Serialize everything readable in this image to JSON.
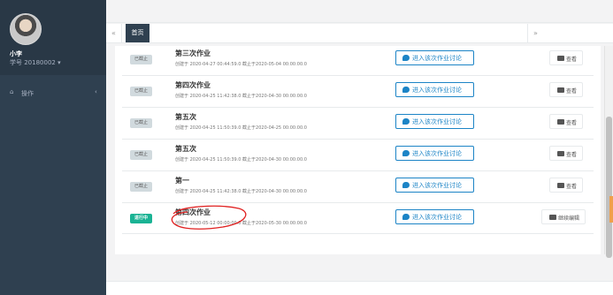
{
  "user": {
    "name": "小李",
    "student_id": "学号 20180002 ▾"
  },
  "sidebar": {
    "items": [
      {
        "label": "操作"
      }
    ]
  },
  "tabs": {
    "prev": "«",
    "next": "»",
    "items": [
      {
        "label": "首页"
      }
    ]
  },
  "assignments": [
    {
      "status": "已截止",
      "status_type": "closed",
      "title": "第三次作业",
      "meta": "创建于 2020-04-27 00:44:59.0 截止于2020-05-04 00:00:00.0",
      "discuss_label": "进入该次作业讨论",
      "action_label": "查看"
    },
    {
      "status": "已截止",
      "status_type": "closed",
      "title": "第四次作业",
      "meta": "创建于 2020-04-25 11:42:38.0 截止于2020-04-30 00:00:00.0",
      "discuss_label": "进入该次作业讨论",
      "action_label": "查看"
    },
    {
      "status": "已截止",
      "status_type": "closed",
      "title": "第五次",
      "meta": "创建于 2020-04-25 11:50:39.0 截止于2020-04-25 00:00:00.0",
      "discuss_label": "进入该次作业讨论",
      "action_label": "查看"
    },
    {
      "status": "已截止",
      "status_type": "closed",
      "title": "第五次",
      "meta": "创建于 2020-04-25 11:50:39.0 截止于2020-04-30 00:00:00.0",
      "discuss_label": "进入该次作业讨论",
      "action_label": "查看"
    },
    {
      "status": "已截止",
      "status_type": "closed",
      "title": "第一",
      "meta": "创建于 2020-04-25 11:42:38.0 截止于2020-04-30 00:00:00.0",
      "discuss_label": "进入该次作业讨论",
      "action_label": "查看"
    },
    {
      "status": "进行中",
      "status_type": "active",
      "title": "第四次作业",
      "meta": "创建于 2020-05-12 00:00:00.0 截止于2020-05-30 00:00:00.0",
      "discuss_label": "进入该次作业讨论",
      "action_label": "继续编辑"
    }
  ],
  "colors": {
    "sidebar": "#2f4050",
    "accent_blue": "#1c84c6",
    "status_active": "#1ab394",
    "annotation_red": "#e02020"
  }
}
